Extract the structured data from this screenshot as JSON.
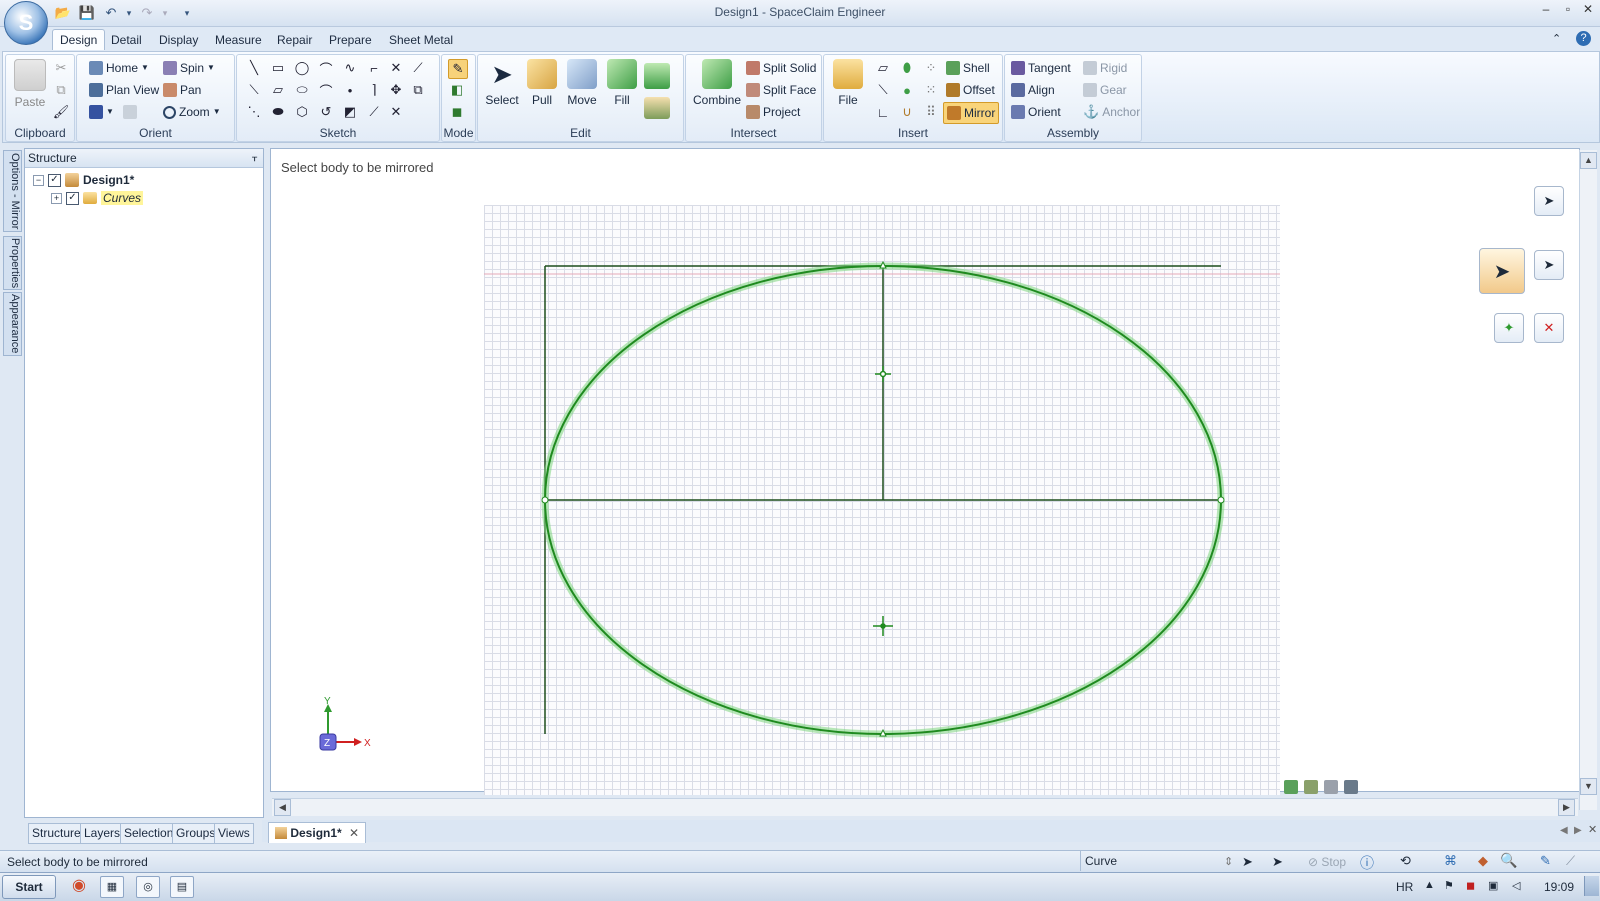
{
  "window": {
    "title": "Design1 - SpaceClaim Engineer",
    "minimize": "–",
    "maximize": "▫",
    "close": "✕"
  },
  "ribbon": {
    "tabs": [
      "Design",
      "Detail",
      "Display",
      "Measure",
      "Repair",
      "Prepare",
      "Sheet Metal"
    ],
    "active_tab": "Design",
    "clipboard": {
      "label": "Clipboard",
      "paste": "Paste"
    },
    "orient": {
      "label": "Orient",
      "home": "Home",
      "plan_view": "Plan View",
      "spin": "Spin",
      "pan": "Pan",
      "zoom": "Zoom"
    },
    "sketch": {
      "label": "Sketch"
    },
    "mode": {
      "label": "Mode"
    },
    "edit": {
      "label": "Edit",
      "select": "Select",
      "pull": "Pull",
      "move": "Move",
      "fill": "Fill"
    },
    "intersect": {
      "label": "Intersect",
      "combine": "Combine",
      "split_solid": "Split Solid",
      "split_face": "Split Face",
      "project": "Project"
    },
    "insert": {
      "label": "Insert",
      "file": "File",
      "shell": "Shell",
      "offset": "Offset",
      "mirror": "Mirror"
    },
    "assembly": {
      "label": "Assembly",
      "tangent": "Tangent",
      "align": "Align",
      "orient": "Orient",
      "rigid": "Rigid",
      "gear": "Gear",
      "anchor": "Anchor"
    }
  },
  "side_tabs": [
    "Options - Mirror",
    "Properties",
    "Appearance"
  ],
  "structure": {
    "title": "Structure",
    "pin": "ᚁ",
    "tree": [
      {
        "label": "Design1*",
        "checked": true,
        "expanded": true
      },
      {
        "label": "Curves",
        "checked": true,
        "expanded": false
      }
    ],
    "bottom_tabs": [
      "Structure",
      "Layers",
      "Selection",
      "Groups",
      "Views"
    ]
  },
  "viewport": {
    "hint": "Select body to be mirrored",
    "axis": {
      "x": "X",
      "y": "Y",
      "z": "Z"
    }
  },
  "document_tab": {
    "label": "Design1*"
  },
  "statusbar": {
    "message": "Select body to be mirrored",
    "selection_type": "Curve",
    "stop": "Stop"
  },
  "taskbar": {
    "start": "Start",
    "language": "HR",
    "time": "19:09"
  },
  "colors": {
    "accent": "#2f6db3",
    "curve": "#1f8a1f",
    "curve_glow": "#7ed67e",
    "sketch_line": "#1d4d1d"
  }
}
